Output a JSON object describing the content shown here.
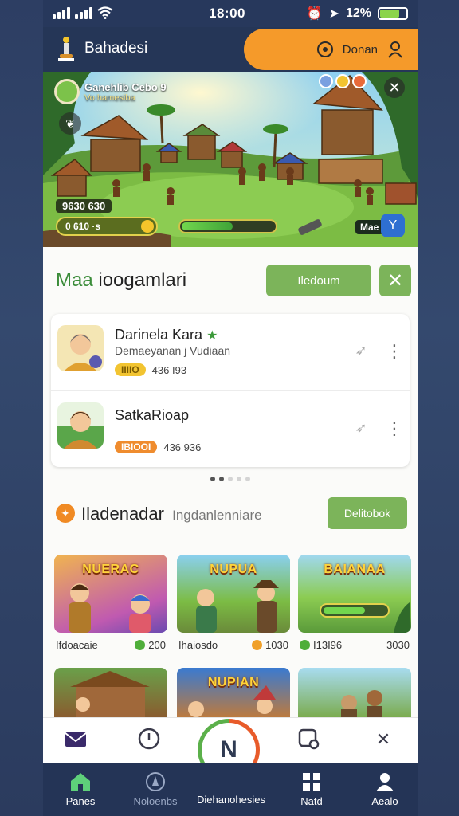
{
  "status_bar": {
    "time": "18:00",
    "battery": "12%"
  },
  "header": {
    "brand": "Bahadesi",
    "account_label": "Donan"
  },
  "hero": {
    "title": "Ganehlib Cebo 9",
    "subtitle": "Vo hamesiba",
    "hp": "9630 630",
    "coins": "0 610 ·s",
    "progress": 0.55,
    "level": "Mae"
  },
  "section1": {
    "title_lead": "Maa",
    "title_rest": "ioogamlari",
    "action_label": "Iledoum"
  },
  "players": [
    {
      "name": "Darinela Kara",
      "starred": true,
      "subtitle": "Demaeyanan j Vudiaan",
      "badge": "IIIIO",
      "count": "436 I93"
    },
    {
      "name": "SatkaRioap",
      "starred": false,
      "subtitle": "",
      "badge": "IBIOOI",
      "count": "436 936"
    }
  ],
  "section2": {
    "title": "Iladenadar",
    "subtitle": "Ingdanlenniare",
    "action_label": "Delitobok"
  },
  "games": [
    {
      "banner": "NUERAC",
      "caption": "Ifdoacaie",
      "stat": "200",
      "stat_kind": "green"
    },
    {
      "banner": "NUPUA",
      "caption": "Ihaiosdo",
      "stat": "1030",
      "stat_kind": "orange"
    },
    {
      "banner": "BAIANAA",
      "caption": "I13I96",
      "stat": "3030",
      "stat_kind": "green"
    },
    {
      "banner": "",
      "caption": "",
      "stat": "",
      "stat_kind": ""
    },
    {
      "banner": "NUPIAN",
      "caption": "",
      "stat": "",
      "stat_kind": ""
    },
    {
      "banner": "",
      "caption": "",
      "stat": "",
      "stat_kind": ""
    }
  ],
  "fab_label": "N",
  "nav": {
    "items": [
      {
        "label": "Panes",
        "icon": "home-icon",
        "active": true
      },
      {
        "label": "Noloenbs",
        "icon": "compass-icon",
        "active": false
      },
      {
        "label": "Diehanohesies",
        "icon": "play-icon",
        "active": false
      },
      {
        "label": "Natd",
        "icon": "grid-icon",
        "active": false
      },
      {
        "label": "Aealo",
        "icon": "user-icon",
        "active": false
      }
    ]
  },
  "colors": {
    "accent_orange": "#f59a2a",
    "accent_green": "#7cb45a",
    "nav_bg": "#243456",
    "active_nav": "#5ed07a"
  }
}
